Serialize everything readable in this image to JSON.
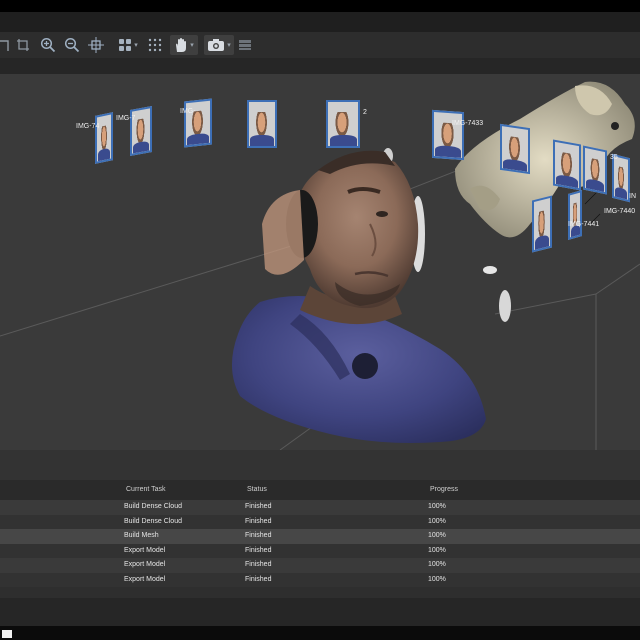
{
  "toolbar": {
    "tools": [
      {
        "name": "crop-tool-icon"
      },
      {
        "name": "zoom-in-icon"
      },
      {
        "name": "zoom-out-icon"
      },
      {
        "name": "move-tool-icon"
      },
      {
        "name": "grid-points-icon"
      },
      {
        "name": "dots-grid-icon"
      },
      {
        "name": "hand-navigation-icon"
      },
      {
        "name": "camera-icon"
      },
      {
        "name": "layers-icon"
      }
    ]
  },
  "viewport": {
    "camera_labels": [
      "IMG-74",
      "IMG-7",
      "IMG-",
      "2",
      "IMG-7433",
      "35",
      "IMG-7440",
      "IMG-7441",
      "IN"
    ]
  },
  "task_table": {
    "columns": [
      "Current Task",
      "Status",
      "Progress"
    ],
    "rows": [
      {
        "task": "Build Dense Cloud",
        "status": "Finished",
        "progress": "100%"
      },
      {
        "task": "Build Dense Cloud",
        "status": "Finished",
        "progress": "100%"
      },
      {
        "task": "Build Mesh",
        "status": "Finished",
        "progress": "100%"
      },
      {
        "task": "Export Model",
        "status": "Finished",
        "progress": "100%"
      },
      {
        "task": "Export Model",
        "status": "Finished",
        "progress": "100%"
      },
      {
        "task": "Export Model",
        "status": "Finished",
        "progress": "100%"
      }
    ]
  },
  "colors": {
    "background": "#3a3a3a",
    "camera_frame": "#3d6fb6",
    "mesh_shirt": "#4a4f8f"
  }
}
